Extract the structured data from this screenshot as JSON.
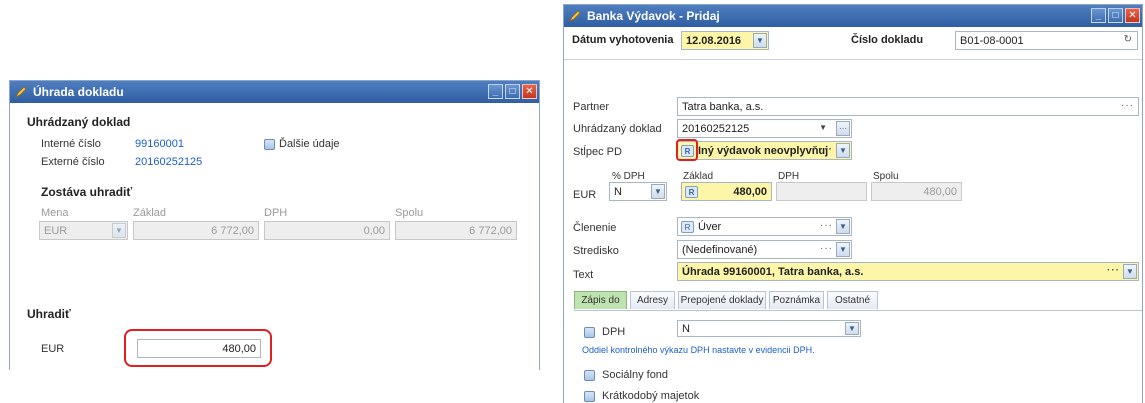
{
  "left_window": {
    "title": "Úhrada dokladu",
    "section_paid_doc": "Uhrádzaný doklad",
    "internal_no_label": "Interné číslo",
    "internal_no_value": "99160001",
    "external_no_label": "Externé číslo",
    "external_no_value": "20160252125",
    "more_data_label": "Ďalšie údaje",
    "section_remaining": "Zostáva uhradiť",
    "col_currency": "Mena",
    "col_base": "Základ",
    "col_vat": "DPH",
    "col_total": "Spolu",
    "currency_value": "EUR",
    "base_value": "6 772,00",
    "vat_value": "0,00",
    "total_value": "6 772,00",
    "section_pay": "Uhradiť",
    "pay_currency_label": "EUR",
    "pay_amount": "480,00"
  },
  "right_window": {
    "title": "Banka Výdavok - Pridaj",
    "date_label": "Dátum vyhotovenia",
    "date_value": "12.08.2016",
    "doc_no_label": "Číslo dokladu",
    "doc_no_value": "B01-08-0001",
    "partner_label": "Partner",
    "partner_value": "Tatra banka, a.s.",
    "paid_doc_label": "Uhrádzaný doklad",
    "paid_doc_value": "20160252125",
    "column_pd_label": "Stĺpec PD",
    "column_pd_value": "Iný výdavok neovplyvňuj",
    "vat_pct_label": "% DPH",
    "base_label": "Základ",
    "vat_label": "DPH",
    "total_label": "Spolu",
    "currency_label": "EUR",
    "vat_pct_value": "N",
    "base_value": "480,00",
    "vat_value": "",
    "total_value": "480,00",
    "division_label": "Členenie",
    "division_value": "Úver",
    "center_label": "Stredisko",
    "center_value": "(Nedefinované)",
    "text_label": "Text",
    "text_value": "Úhrada 99160001, Tatra banka, a.s.",
    "r_badge": "R",
    "tabs": [
      "Zápis do",
      "Adresy",
      "Prepojené doklady",
      "Poznámka",
      "Ostatné"
    ],
    "vat_checkbox_label": "DPH",
    "vat_select_value": "N",
    "vat_note": "Oddiel kontrolného výkazu DPH nastavte v evidencii DPH.",
    "social_fund_label": "Sociálny fond",
    "short_asset_label": "Krátkodobý majetok"
  }
}
